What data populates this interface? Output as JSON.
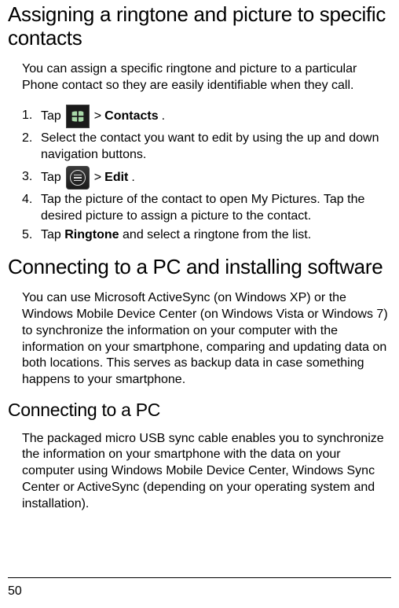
{
  "headings": {
    "h1_ringtone": "Assigning a ringtone and picture to specific contacts",
    "h1_connecting": "Connecting to a PC and installing software",
    "h2_connect_pc": "Connecting to a PC"
  },
  "paragraphs": {
    "ringtone_intro": "You can assign a specific ringtone and picture to a particular Phone contact so they are easily identifiable when they call.",
    "connect_intro": "You can use Microsoft ActiveSync (on Windows XP) or the Windows Mobile Device Center (on Windows Vista or Windows 7) to synchronize the information on your computer with the information on your smartphone, comparing and updating data on both locations. This serves as backup data in case something happens to your smartphone.",
    "pc_para": "The packaged micro USB sync cable enables you to synchronize the information on your smartphone with the data on your computer using Windows Mobile Device Center, Windows Sync Center or ActiveSync (depending on your operating system and installation)."
  },
  "steps": {
    "s1_pre": "Tap",
    "s1_sep": ">",
    "s1_bold": "Contacts",
    "s1_post": ".",
    "s2": "Select the contact you want to edit by using the up and down navigation buttons.",
    "s3_pre": "Tap",
    "s3_sep": ">",
    "s3_bold": "Edit",
    "s3_post": ".",
    "s4": "Tap the picture of the contact to open My Pictures. Tap the desired picture to assign a picture to the contact.",
    "s5_pre": "Tap ",
    "s5_bold": "Ringtone",
    "s5_post": " and select a ringtone from the list."
  },
  "page_number": "50"
}
